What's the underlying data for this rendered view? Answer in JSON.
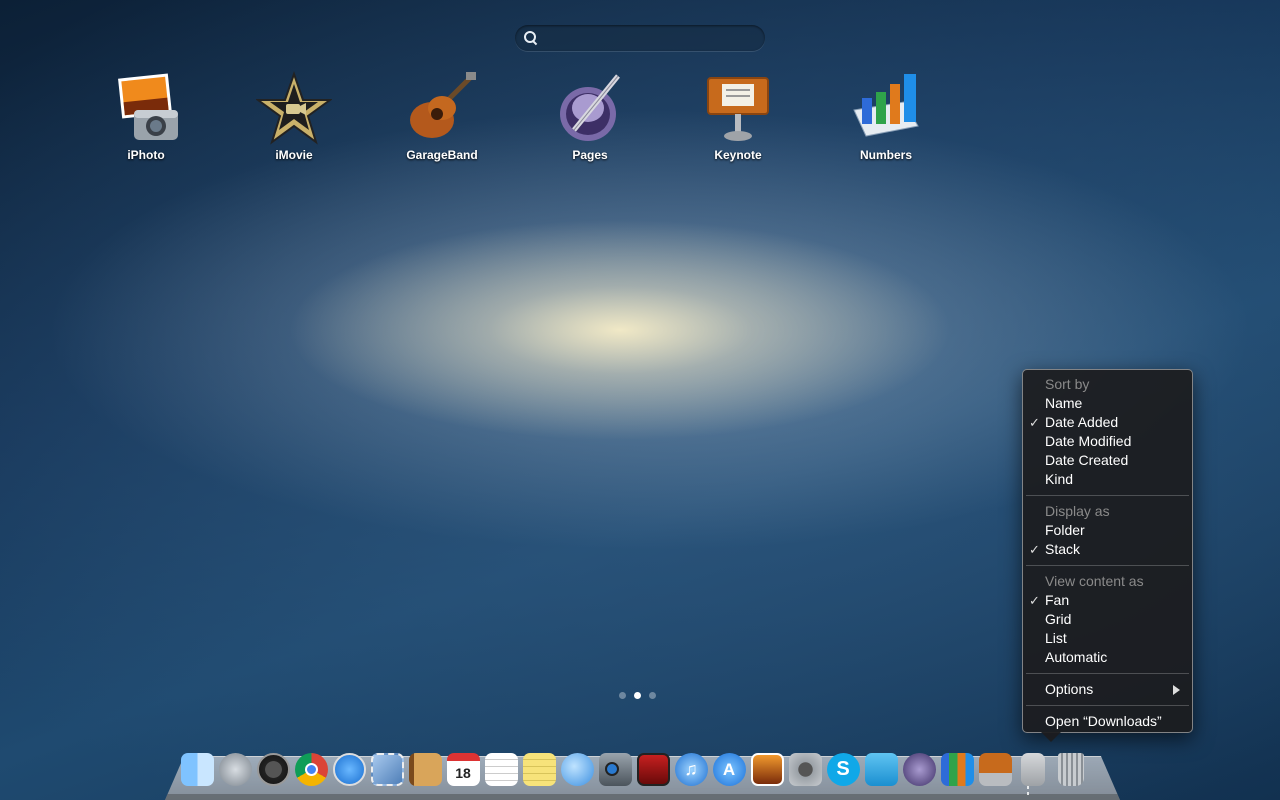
{
  "search": {
    "placeholder": ""
  },
  "apps": [
    {
      "label": "iPhoto",
      "icon": "iphoto-icon"
    },
    {
      "label": "iMovie",
      "icon": "imovie-icon"
    },
    {
      "label": "GarageBand",
      "icon": "garageband-icon"
    },
    {
      "label": "Pages",
      "icon": "pages-icon"
    },
    {
      "label": "Keynote",
      "icon": "keynote-icon"
    },
    {
      "label": "Numbers",
      "icon": "numbers-icon"
    }
  ],
  "page_dots": {
    "count": 3,
    "active_index": 1
  },
  "context_menu": {
    "sort_by": {
      "header": "Sort by",
      "items": [
        "Name",
        "Date Added",
        "Date Modified",
        "Date Created",
        "Kind"
      ],
      "checked": "Date Added"
    },
    "display_as": {
      "header": "Display as",
      "items": [
        "Folder",
        "Stack"
      ],
      "checked": "Stack"
    },
    "view_content_as": {
      "header": "View content as",
      "items": [
        "Fan",
        "Grid",
        "List",
        "Automatic"
      ],
      "checked": "Fan"
    },
    "options_label": "Options",
    "open_label": "Open “Downloads”",
    "check_glyph": "✓"
  },
  "calendar_icon_day": "18",
  "dock": [
    "finder-icon",
    "launchpad-icon",
    "dashboard-icon",
    "chrome-icon",
    "safari-icon",
    "mail-stamp-icon",
    "contacts-icon",
    "calendar-icon",
    "reminders-icon",
    "notes-icon",
    "messages-icon",
    "facetime-icon",
    "photo-booth-icon",
    "itunes-icon",
    "app-store-icon",
    "iphoto-icon",
    "system-preferences-icon",
    "skype-icon",
    "twitter-icon",
    "pages-icon",
    "numbers-icon",
    "keynote-icon",
    "downloads-stack-icon",
    "trash-icon"
  ]
}
